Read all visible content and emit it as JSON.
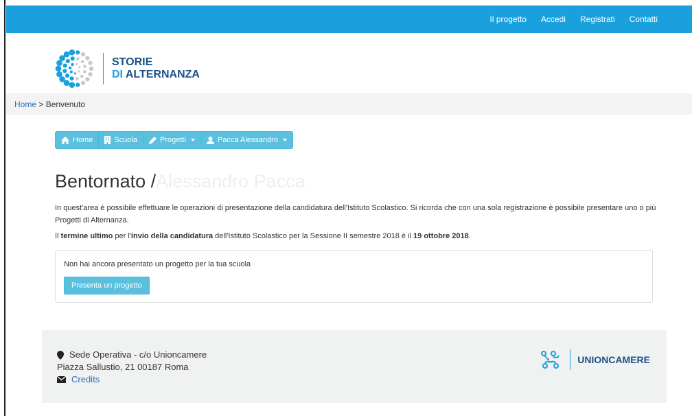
{
  "topnav": {
    "items": [
      "Il progetto",
      "Accedi",
      "Registrati",
      "Contatti"
    ]
  },
  "brand": {
    "line1": "STORIE",
    "line2_di": "DI",
    "line2_rest": " ALTERNANZA",
    "logo_icon": "dots-circle-logo"
  },
  "breadcrumb": {
    "home": "Home",
    "separator": " > ",
    "current": "Benvenuto"
  },
  "navpills": {
    "home": "Home",
    "scuola": "Scuola",
    "progetti": "Progetti",
    "user": "Pacca Alessandro"
  },
  "main": {
    "welcome_prefix": "Bentornato /",
    "welcome_name": "Alessandro Pacca",
    "paragraph1": "In quest'area è possibile effettuare le operazioni di presentazione della candidatura dell'Istituto Scolastico. Si ricorda che con una sola registrazione è possibile presentare uno o più Progetti di Alternanza.",
    "p2_a": "Il ",
    "p2_b": "termine ultimo",
    "p2_c": " per l'",
    "p2_d": "invio della candidatura",
    "p2_e": " dell'Istituto Scolastico per la Sessione II semestre 2018 è il ",
    "p2_f": "19 ottobre 2018",
    "p2_g": "."
  },
  "panel": {
    "message": "Non hai ancora presentato un progetto per la tua scuola",
    "button": "Presenta un progetto"
  },
  "footer": {
    "address_title": "Sede Operativa - c/o Unioncamere",
    "address_line": "Piazza Sallustio, 21 00187 Roma",
    "credits": "Credits",
    "partner": "UNIONCAMERE"
  },
  "colors": {
    "primary": "#1ba0de",
    "info": "#5bc0de",
    "dark_blue": "#1b4f8a",
    "link": "#2a6fb5"
  }
}
